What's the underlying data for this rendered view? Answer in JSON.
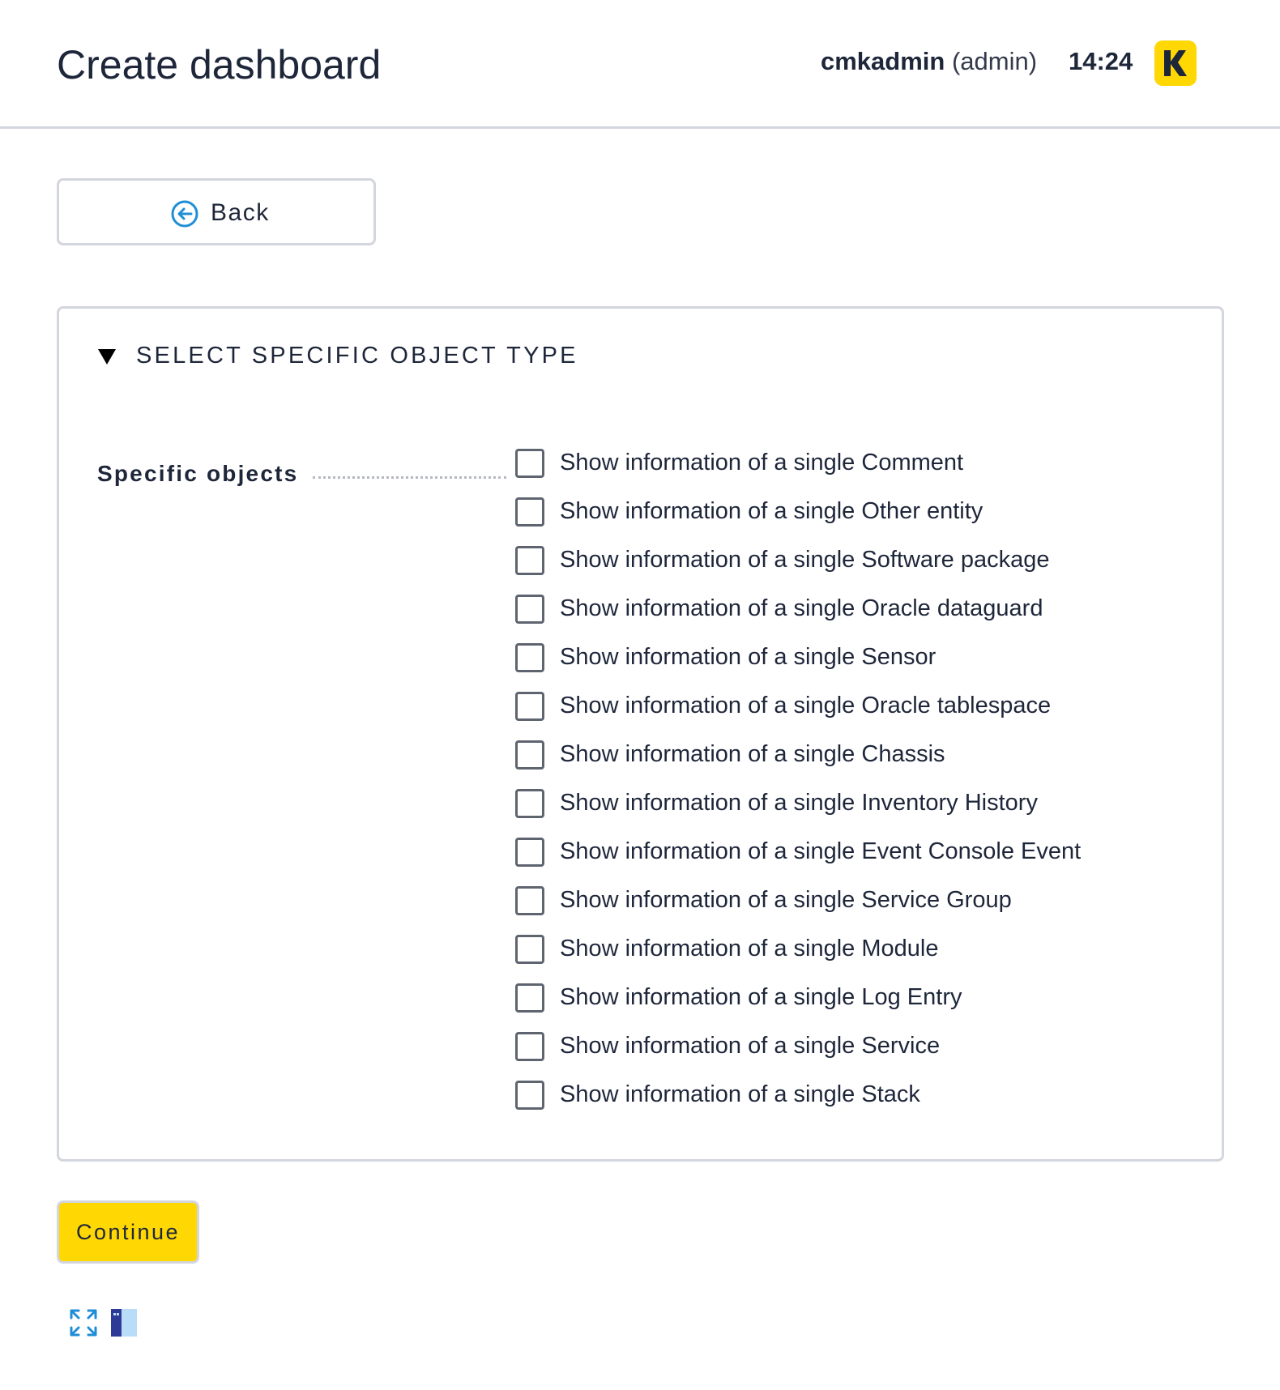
{
  "header": {
    "title": "Create dashboard",
    "user_name": "cmkadmin",
    "user_role": "(admin)",
    "clock": "14:24",
    "logo_icon": "checkmk-logo-icon",
    "logo_color": "#ffd703"
  },
  "back_button": {
    "label": "Back",
    "icon": "back-arrow-circle-icon",
    "icon_color": "#1f8ed6"
  },
  "section": {
    "title": "SELECT SPECIFIC OBJECT TYPE",
    "expanded": true,
    "field_label": "Specific objects",
    "options": [
      {
        "label": "Show information of a single Comment",
        "checked": false
      },
      {
        "label": "Show information of a single Other entity",
        "checked": false
      },
      {
        "label": "Show information of a single Software package",
        "checked": false
      },
      {
        "label": "Show information of a single Oracle dataguard",
        "checked": false
      },
      {
        "label": "Show information of a single Sensor",
        "checked": false
      },
      {
        "label": "Show information of a single Oracle tablespace",
        "checked": false
      },
      {
        "label": "Show information of a single Chassis",
        "checked": false
      },
      {
        "label": "Show information of a single Inventory History",
        "checked": false
      },
      {
        "label": "Show information of a single Event Console Event",
        "checked": false
      },
      {
        "label": "Show information of a single Service Group",
        "checked": false
      },
      {
        "label": "Show information of a single Module",
        "checked": false
      },
      {
        "label": "Show information of a single Log Entry",
        "checked": false
      },
      {
        "label": "Show information of a single Service",
        "checked": false
      },
      {
        "label": "Show information of a single Stack",
        "checked": false
      }
    ]
  },
  "continue_button": {
    "label": "Continue",
    "color": "#ffd703"
  },
  "footer_icons": [
    "fullscreen-icon",
    "sidebar-toggle-icon"
  ]
}
